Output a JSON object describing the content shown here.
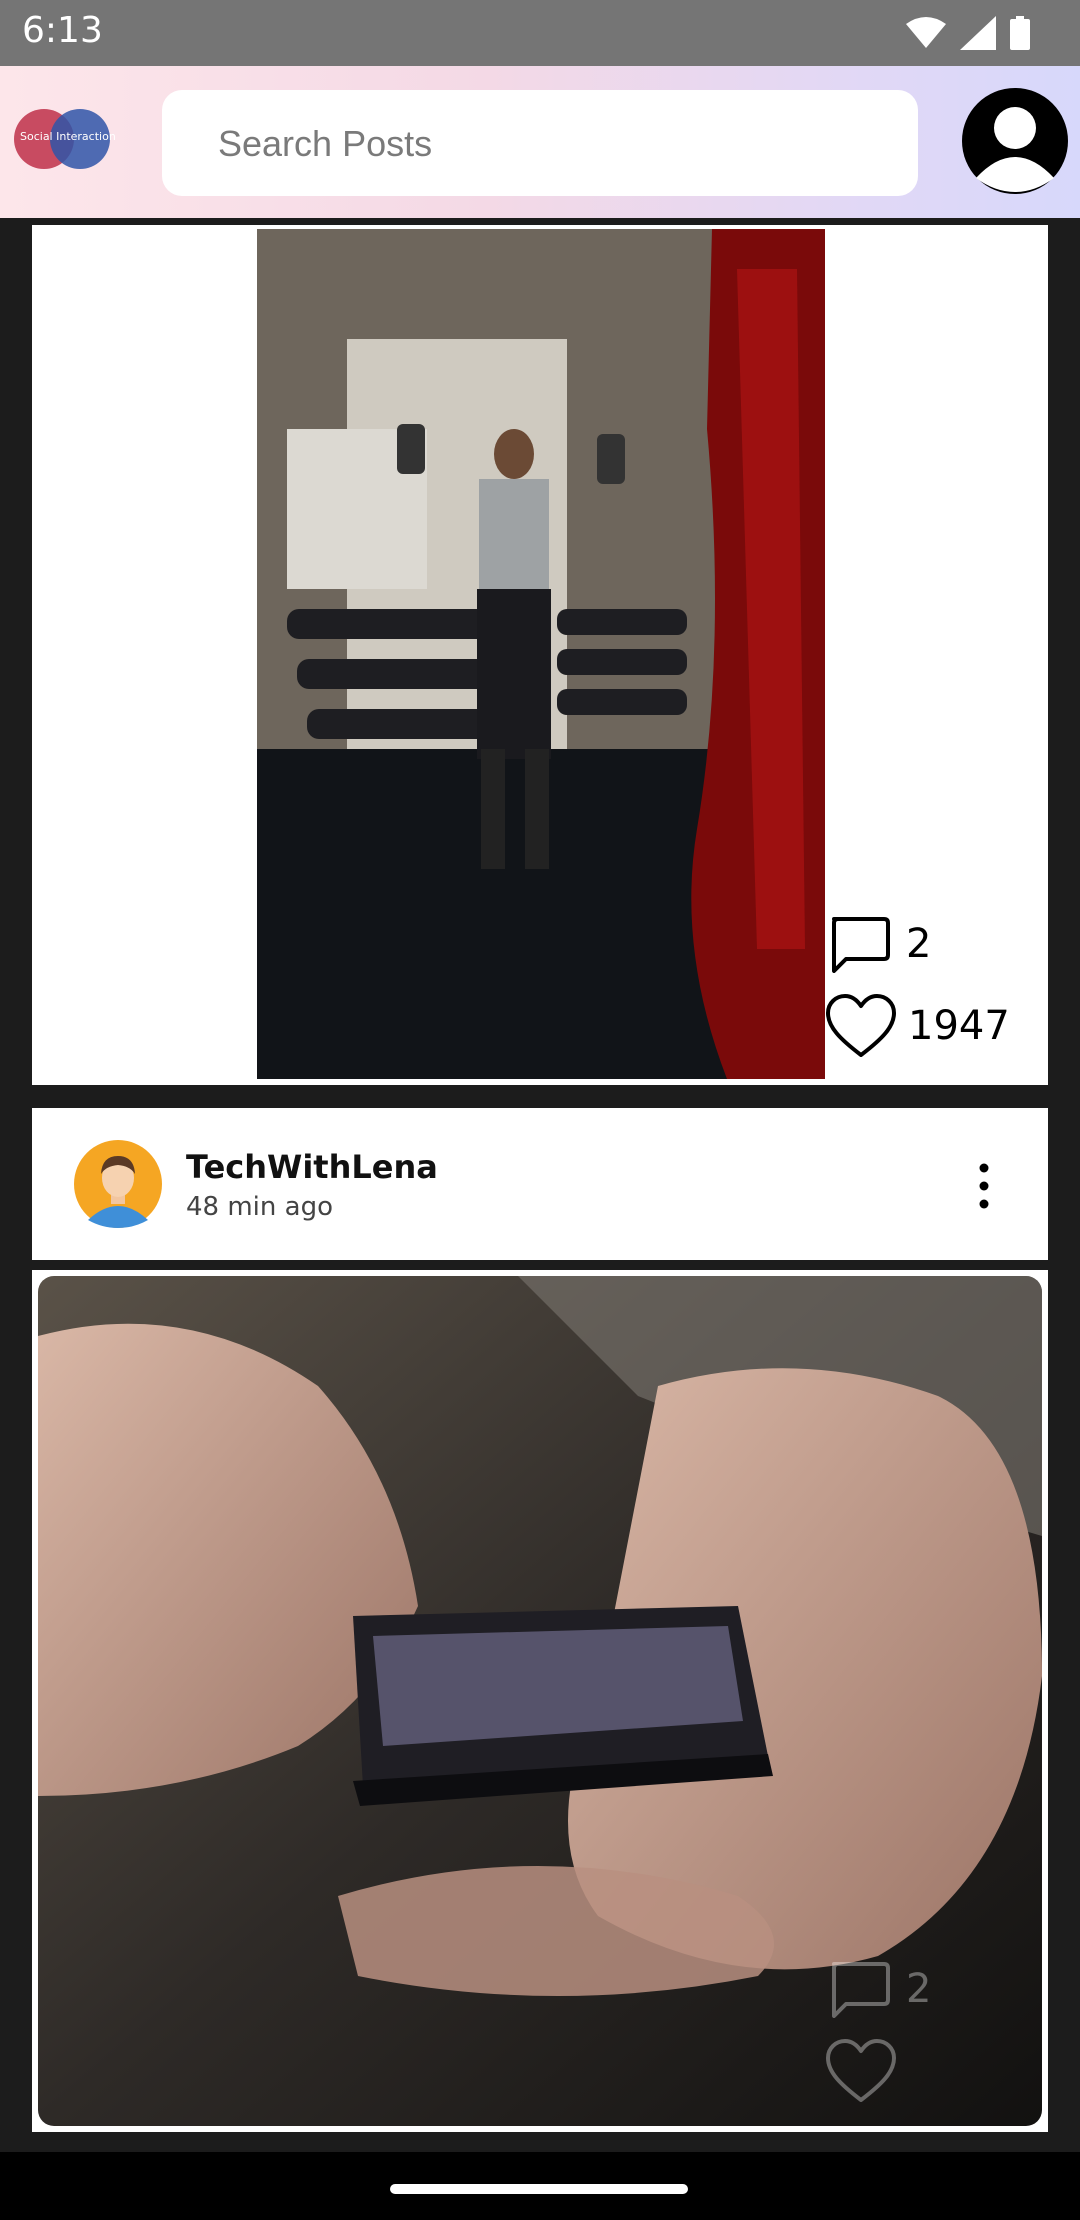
{
  "status_bar": {
    "time": "6:13",
    "icons": [
      "wifi-icon",
      "signal-icon",
      "battery-icon"
    ]
  },
  "header": {
    "logo_text": "Social Interaction",
    "search": {
      "placeholder": "Search Posts",
      "value": ""
    },
    "avatar_icon": "user-avatar-icon"
  },
  "posts": [
    {
      "image": "gym-dumbbell-photo",
      "comments": "2",
      "likes": "1947"
    },
    {
      "username": "TechWithLena",
      "time_ago": "48 min ago",
      "image": "phone-typing-photo",
      "comments": "2"
    }
  ],
  "colors": {
    "background": "#1c1c1c",
    "status_bar": "#757575",
    "header_gradient_start": "#fde6ea",
    "header_gradient_end": "#d7d8fb",
    "card": "#ffffff"
  }
}
